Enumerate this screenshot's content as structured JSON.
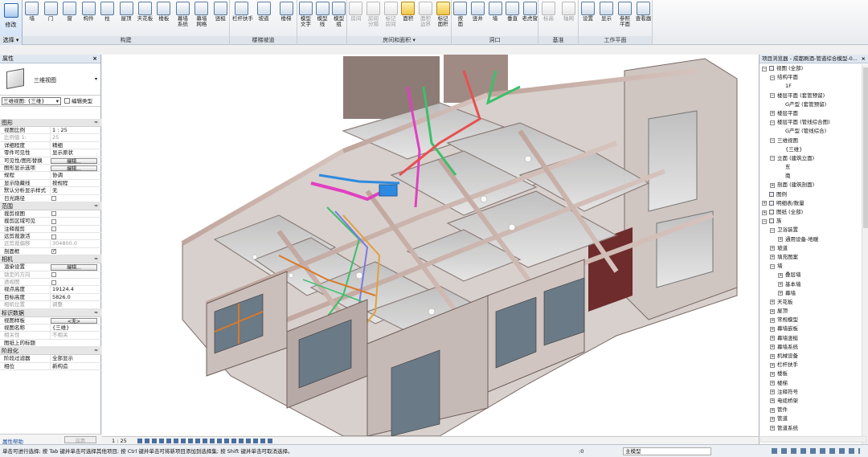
{
  "ribbon": {
    "mode": {
      "label": "修改",
      "group": "选择 ▾"
    },
    "groups": [
      {
        "label": "构建",
        "buttons": [
          "墙",
          "门",
          "窗",
          "构件",
          "柱",
          "屋顶",
          "天花板",
          "楼板",
          "幕墙\n系统",
          "幕墙\n网格",
          "竖梃"
        ]
      },
      {
        "label": "楼梯坡道",
        "buttons": [
          "栏杆扶手",
          "坡道",
          "楼梯"
        ]
      },
      {
        "label": "",
        "buttons": [
          "模型\n文字",
          "模型\n线",
          "模型\n组"
        ]
      },
      {
        "label": "房间和面积 ▾",
        "buttons": [
          "房间",
          "房间\n分隔",
          "标记\n房间",
          "面积",
          "面积\n边界",
          "标记\n面积"
        ]
      },
      {
        "label": "洞口",
        "buttons": [
          "按\n面",
          "竖井",
          "墙",
          "垂直",
          "老虎窗"
        ]
      },
      {
        "label": "基准",
        "buttons": [
          "标高",
          "轴网"
        ]
      },
      {
        "label": "工作平面",
        "buttons": [
          "设置",
          "显示",
          "参照\n平面",
          "查看器"
        ]
      }
    ]
  },
  "properties": {
    "title": "属性",
    "close": "×",
    "type_name": "三维视图",
    "type_dropdown": "▾",
    "instance_selector": "三维视图: {三维}",
    "instance_dropdown": "▾",
    "edit_type": "编辑类型",
    "sections": [
      {
        "name": "图形",
        "rows": [
          {
            "k": "视图比例",
            "v": "1 : 25",
            "type": "input"
          },
          {
            "k": "比例值 1:",
            "v": "25",
            "gray": true
          },
          {
            "k": "详细程度",
            "v": "精细"
          },
          {
            "k": "零件可见性",
            "v": "显示原状"
          },
          {
            "k": "可见性/图形替换",
            "v": "编辑...",
            "type": "button"
          },
          {
            "k": "图形显示选项",
            "v": "编辑...",
            "type": "button"
          },
          {
            "k": "规程",
            "v": "协调"
          },
          {
            "k": "显示隐藏线",
            "v": "按规程"
          },
          {
            "k": "默认分析显示样式",
            "v": "无"
          },
          {
            "k": "日光路径",
            "v": "",
            "type": "check"
          }
        ]
      },
      {
        "name": "范围",
        "rows": [
          {
            "k": "裁剪视图",
            "v": "",
            "type": "check"
          },
          {
            "k": "裁剪区域可见",
            "v": "",
            "type": "check"
          },
          {
            "k": "注释裁剪",
            "v": "",
            "type": "check"
          },
          {
            "k": "远剪裁激活",
            "v": "",
            "type": "check"
          },
          {
            "k": "远剪裁偏移",
            "v": "304800.0",
            "gray": true
          },
          {
            "k": "剖面框",
            "v": "",
            "type": "check",
            "on": true
          }
        ]
      },
      {
        "name": "相机",
        "rows": [
          {
            "k": "渲染设置",
            "v": "编辑...",
            "type": "button"
          },
          {
            "k": "锁定的方向",
            "v": "",
            "type": "check",
            "gray": true
          },
          {
            "k": "透视图",
            "v": "",
            "type": "check",
            "gray": true
          },
          {
            "k": "视点高度",
            "v": "19124.4"
          },
          {
            "k": "目标高度",
            "v": "5826.0"
          },
          {
            "k": "相机位置",
            "v": "调整",
            "gray": true
          }
        ]
      },
      {
        "name": "标识数据",
        "rows": [
          {
            "k": "视图样板",
            "v": "<无>",
            "type": "button"
          },
          {
            "k": "视图名称",
            "v": "{三维}"
          },
          {
            "k": "相关性",
            "v": "不相关",
            "gray": true
          },
          {
            "k": "图纸上的标题",
            "v": ""
          }
        ]
      },
      {
        "name": "阶段化",
        "rows": [
          {
            "k": "阶段过滤器",
            "v": "全部显示"
          },
          {
            "k": "相位",
            "v": "新构造"
          }
        ]
      }
    ],
    "collapse": "≈",
    "help_link": "属性帮助",
    "apply": "应用"
  },
  "browser": {
    "title": "项目浏览器 - 成都刷酒-管道综合模型-0...",
    "close": "×",
    "items": [
      {
        "d": 0,
        "t": "−",
        "label": "视图 (全部)",
        "icon": true
      },
      {
        "d": 1,
        "t": "−",
        "label": "结构平面"
      },
      {
        "d": 2,
        "t": "",
        "label": "1F"
      },
      {
        "d": 1,
        "t": "−",
        "label": "楼层平面 (套管预留)"
      },
      {
        "d": 2,
        "t": "",
        "label": "G产型 (套管预留)"
      },
      {
        "d": 1,
        "t": "+",
        "label": "楼层平面"
      },
      {
        "d": 1,
        "t": "−",
        "label": "楼层平面 (管线综合图)"
      },
      {
        "d": 2,
        "t": "",
        "label": "G产型 (管线综合)"
      },
      {
        "d": 1,
        "t": "−",
        "label": "三维视图"
      },
      {
        "d": 2,
        "t": "",
        "label": "{三维}"
      },
      {
        "d": 1,
        "t": "−",
        "label": "立面 (建筑立面)"
      },
      {
        "d": 2,
        "t": "",
        "label": "东"
      },
      {
        "d": 2,
        "t": "",
        "label": "南"
      },
      {
        "d": 1,
        "t": "+",
        "label": "剖面 (建筑剖面)"
      },
      {
        "d": 0,
        "t": "",
        "label": "图例",
        "icon": true
      },
      {
        "d": 0,
        "t": "+",
        "label": "明细表/数量",
        "icon": true
      },
      {
        "d": 0,
        "t": "+",
        "label": "图纸 (全部)",
        "icon": true
      },
      {
        "d": 0,
        "t": "−",
        "label": "族",
        "icon": true
      },
      {
        "d": 1,
        "t": "−",
        "label": "卫浴装置"
      },
      {
        "d": 2,
        "t": "+",
        "label": "通用设备-地暖"
      },
      {
        "d": 1,
        "t": "+",
        "label": "坡道"
      },
      {
        "d": 1,
        "t": "+",
        "label": "填充图案"
      },
      {
        "d": 1,
        "t": "−",
        "label": "墙"
      },
      {
        "d": 2,
        "t": "+",
        "label": "叠层墙"
      },
      {
        "d": 2,
        "t": "+",
        "label": "基本墙"
      },
      {
        "d": 2,
        "t": "+",
        "label": "幕墙"
      },
      {
        "d": 1,
        "t": "+",
        "label": "天花板"
      },
      {
        "d": 1,
        "t": "+",
        "label": "屋顶"
      },
      {
        "d": 1,
        "t": "+",
        "label": "常规模型"
      },
      {
        "d": 1,
        "t": "+",
        "label": "幕墙嵌板"
      },
      {
        "d": 1,
        "t": "+",
        "label": "幕墙竖梃"
      },
      {
        "d": 1,
        "t": "+",
        "label": "幕墙系统"
      },
      {
        "d": 1,
        "t": "+",
        "label": "机械设备"
      },
      {
        "d": 1,
        "t": "+",
        "label": "栏杆扶手"
      },
      {
        "d": 1,
        "t": "+",
        "label": "楼板"
      },
      {
        "d": 1,
        "t": "+",
        "label": "楼梯"
      },
      {
        "d": 1,
        "t": "+",
        "label": "注释符号"
      },
      {
        "d": 1,
        "t": "+",
        "label": "电缆桥架"
      },
      {
        "d": 1,
        "t": "+",
        "label": "管件"
      },
      {
        "d": 1,
        "t": "+",
        "label": "管道"
      },
      {
        "d": 1,
        "t": "+",
        "label": "管道系统"
      }
    ]
  },
  "viewbar": {
    "scale": "1 : 25"
  },
  "status": {
    "message": "单击可进行选择; 按 Tab 键并单击可选择其他项目; 按 Ctrl 键并单击可将新项目添加到选择集; 按 Shift 键并单击可取消选择。",
    "zero": ":0",
    "model": "主模型"
  },
  "colors": {
    "accent": "#2c63a8",
    "wall": "#c9b3ac",
    "slab": "#d9d9d9",
    "pipe_pink": "#e040c0",
    "pipe_green": "#3cbf6a",
    "pipe_blue": "#2d8ae0",
    "orange": "#d97a2a"
  }
}
